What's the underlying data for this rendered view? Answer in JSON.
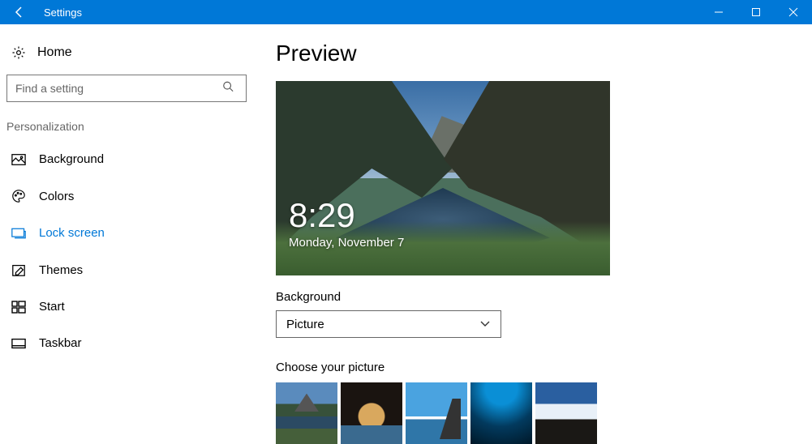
{
  "titlebar": {
    "title": "Settings"
  },
  "sidebar": {
    "home_label": "Home",
    "search_placeholder": "Find a setting",
    "section_header": "Personalization",
    "items": [
      {
        "label": "Background",
        "active": false
      },
      {
        "label": "Colors",
        "active": false
      },
      {
        "label": "Lock screen",
        "active": true
      },
      {
        "label": "Themes",
        "active": false
      },
      {
        "label": "Start",
        "active": false
      },
      {
        "label": "Taskbar",
        "active": false
      }
    ]
  },
  "content": {
    "page_title": "Preview",
    "lock_time": "8:29",
    "lock_date": "Monday, November 7",
    "background_label": "Background",
    "background_dropdown_value": "Picture",
    "choose_picture_label": "Choose your picture"
  }
}
